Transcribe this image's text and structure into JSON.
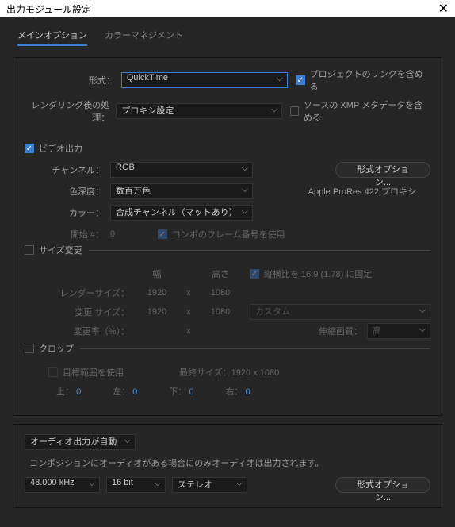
{
  "title": "出力モジュール設定",
  "tabs": {
    "main": "メインオプション",
    "color": "カラーマネジメント"
  },
  "form": {
    "format_label": "形式：",
    "format_value": "QuickTime",
    "include_link": "プロジェクトのリンクを含める",
    "post_render_label": "レンダリング後の処理：",
    "post_render_value": "プロキシ設定",
    "include_xmp": "ソースの XMP メタデータを含める"
  },
  "video": {
    "enable": "ビデオ出力",
    "channel_label": "チャンネル：",
    "channel_value": "RGB",
    "format_options_btn": "形式オプション...",
    "depth_label": "色深度：",
    "depth_value": "数百万色",
    "codec_info": "Apple ProRes 422 プロキシ",
    "color_label": "カラー：",
    "color_value": "合成チャンネル（マットあり）",
    "start_label": "開始 #：",
    "start_value": "0",
    "use_comp_frame": "コンポのフレーム番号を使用"
  },
  "resize": {
    "title": "サイズ変更",
    "width_h": "幅",
    "height_h": "高さ",
    "lock_aspect": "縦横比を 16:9 (1.78) に固定",
    "render_size_label": "レンダーサイズ：",
    "render_w": "1920",
    "render_h": "1080",
    "change_size_label": "変更 サイズ：",
    "change_w": "1920",
    "change_h": "1080",
    "preset": "カスタム",
    "ratio_label": "変更率（%）：",
    "x_sep": "x",
    "stretch_label": "伸縮画質：",
    "stretch_value": "高"
  },
  "crop": {
    "title": "クロップ",
    "use_roi": "目標範囲を使用",
    "final_size_label": "最終サイズ：1920 x 1080",
    "top": "上：",
    "left": "左：",
    "bottom": "下：",
    "right": "右：",
    "zero": "0"
  },
  "audio": {
    "mode": "オーディオ出力が自動",
    "note": "コンポジションにオーディオがある場合にのみオーディオは出力されます。",
    "rate": "48.000 kHz",
    "bit": "16 bit",
    "ch": "ステレオ",
    "format_options_btn": "形式オプション..."
  }
}
